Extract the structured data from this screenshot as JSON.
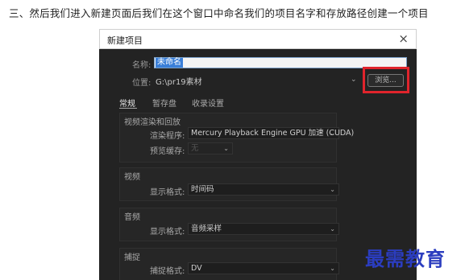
{
  "caption": "三、然后我们进入新建页面后我们在这个窗口中命名我们的项目名字和存放路径创建一个项目",
  "dialog": {
    "title": "新建项目",
    "close_icon": "×",
    "name_label": "名称:",
    "name_value": "未命名",
    "location_label": "位置:",
    "location_value": "G:\\pr19素材",
    "browse_label": "浏览...",
    "tabs": [
      "常规",
      "暂存盘",
      "收录设置"
    ],
    "sections": {
      "video_render": {
        "title": "视频渲染和回放",
        "renderer_label": "渲染程序:",
        "renderer_value": "Mercury Playback Engine GPU 加速 (CUDA)",
        "preview_cache_label": "预览缓存:",
        "preview_cache_value": "无"
      },
      "video": {
        "title": "视频",
        "display_format_label": "显示格式:",
        "display_format_value": "时间码"
      },
      "audio": {
        "title": "音频",
        "display_format_label": "显示格式:",
        "display_format_value": "音频采样"
      },
      "capture": {
        "title": "捕捉",
        "capture_format_label": "捕捉格式:",
        "capture_format_value": "DV"
      }
    }
  },
  "watermark": "最需教育",
  "colors": {
    "highlight_box": "#e0242c",
    "watermark": "#2b3dbf",
    "dialog_bg": "#232323"
  }
}
